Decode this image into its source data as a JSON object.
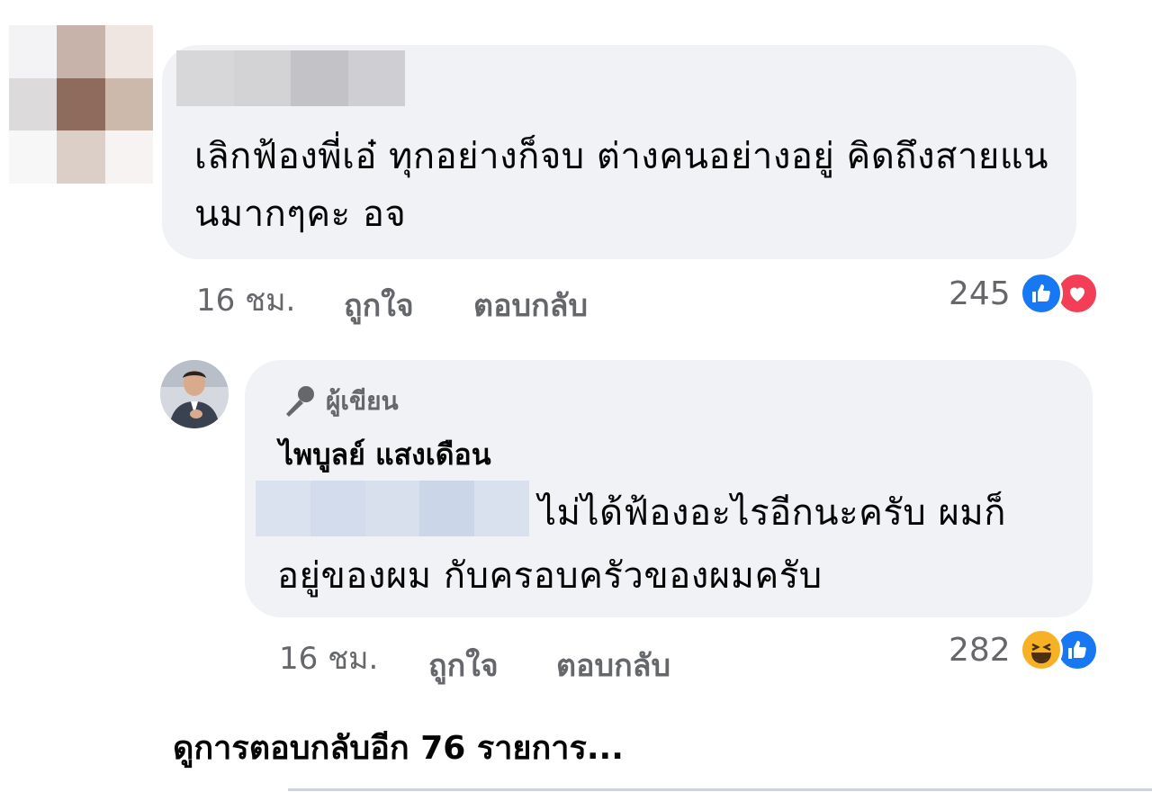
{
  "comment1": {
    "text": "เลิกฟ้องพี่เอ๋ ทุกอย่างก็จบ ต่างคนอย่างอยู่ คิดถึงสายแนนมากๆคะ อจ",
    "time": "16 ชม.",
    "like_label": "ถูกใจ",
    "reply_label": "ตอบกลับ",
    "reaction_count": "245",
    "reactions": [
      "like-icon",
      "love-icon"
    ]
  },
  "comment2": {
    "author_badge": "ผู้เขียน",
    "author_name": "ไพบูลย์ แสงเดือน",
    "text_line1": "ไม่ได้ฟ้องอะไรอีกนะครับ ผมก็",
    "text_line2": "อยู่ของผม กับครอบครัวของผมครับ",
    "time": "16 ชม.",
    "like_label": "ถูกใจ",
    "reply_label": "ตอบกลับ",
    "reaction_count": "282",
    "reactions": [
      "haha-icon",
      "like-icon"
    ]
  },
  "more_replies": "ดูการตอบกลับอีก 76 รายการ...",
  "colors": {
    "bubble": "#f0f2f5",
    "meta_text": "#65676b",
    "like_blue": "#1877f2",
    "love_red": "#f33e58",
    "haha_yellow": "#f7b125"
  }
}
